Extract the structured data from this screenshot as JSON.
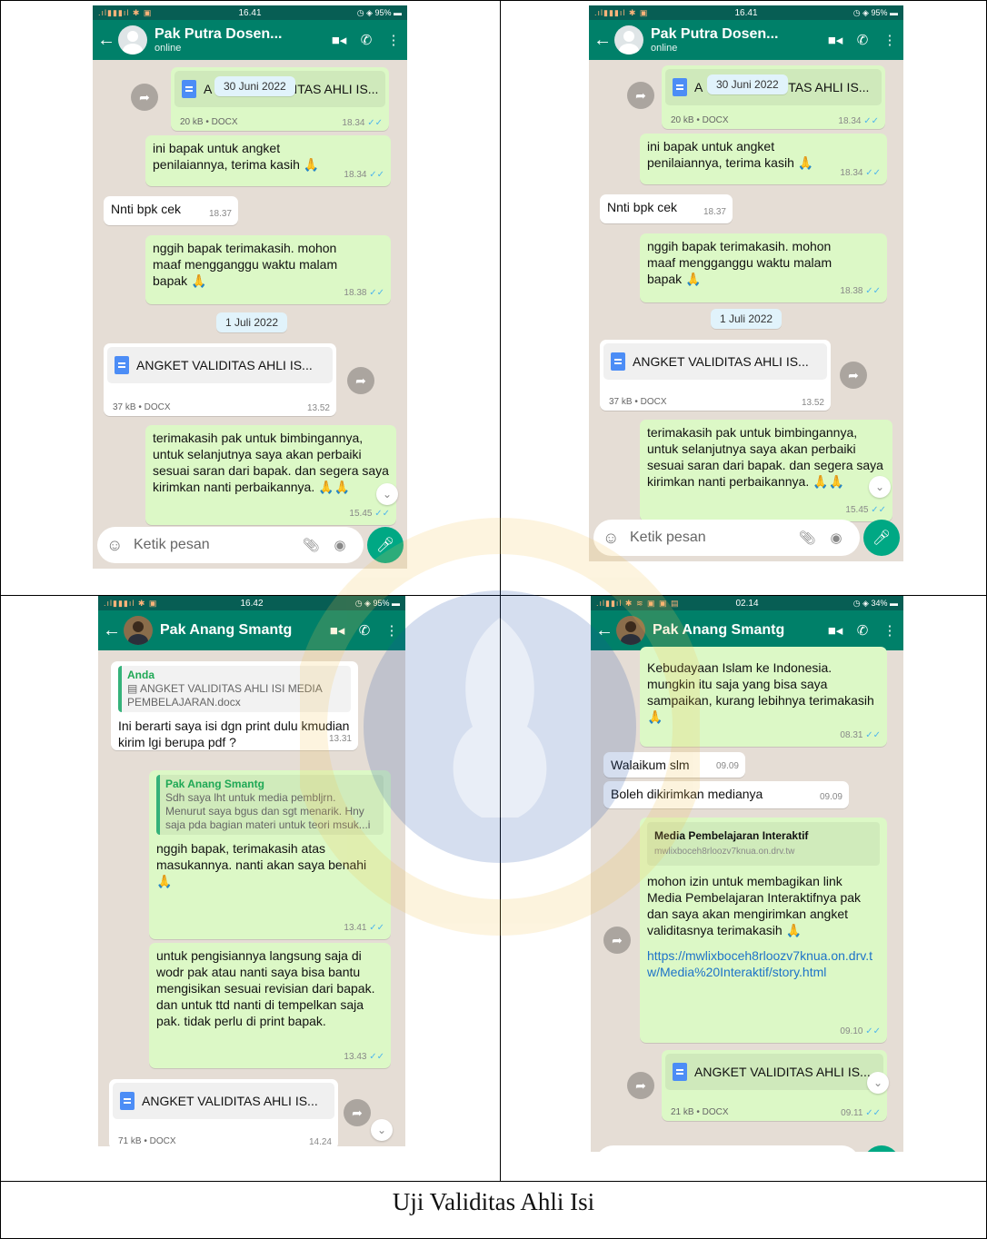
{
  "caption": "Uji Validitas Ahli Isi",
  "icons": {
    "back": "arrow-left-icon",
    "video": "video-camera-icon",
    "call": "phone-icon",
    "menu": "more-vert-icon",
    "forward": "forward-icon",
    "scroll": "chevron-down-icon",
    "emoji": "emoji-icon",
    "attach": "paperclip-icon",
    "camera": "camera-icon",
    "mic": "microphone-icon",
    "pray": "folded-hands-emoji"
  },
  "colors": {
    "header": "#008069",
    "outgoing": "#dcf8c6",
    "incoming": "#ffffff",
    "background": "#e5ddd5",
    "mic": "#00a884",
    "read_tick": "#4fb6ec"
  },
  "input_placeholder": "Ketik pesan",
  "phones": [
    {
      "status_time": "16.41",
      "battery": "95%",
      "contact": "Pak Putra Dosen...",
      "subtitle": "online",
      "file1_name": "A",
      "file1_name_end": "ITAS AHLI IS...",
      "file1_meta": "20 kB • DOCX",
      "file1_time": "18.34",
      "date_chip_1": "30 Juni 2022",
      "msg1": "ini bapak untuk angket penilaiannya, terima kasih 🙏",
      "msg1_time": "18.34",
      "msg2": "Nnti bpk cek",
      "msg2_time": "18.37",
      "msg3": "nggih bapak terimakasih. mohon maaf mengganggu waktu malam bapak 🙏",
      "msg3_time": "18.38",
      "date_chip_2": "1 Juli 2022",
      "file2_name": "ANGKET VALIDITAS AHLI IS...",
      "file2_meta": "37 kB • DOCX",
      "file2_time": "13.52",
      "msg4": "terimakasih pak untuk bimbingannya, untuk selanjutnya saya akan perbaiki sesuai saran dari bapak. dan segera saya kirimkan nanti perbaikannya. 🙏🙏",
      "msg4_time": "15.45"
    },
    {
      "status_time": "16.41",
      "battery": "95%",
      "contact": "Pak Putra Dosen...",
      "subtitle": "online",
      "file1_name": "A",
      "file1_name_end": "ITAS AHLI IS...",
      "file1_meta": "20 kB • DOCX",
      "file1_time": "18.34",
      "date_chip_1": "30 Juni 2022",
      "msg1": "ini bapak untuk angket penilaiannya, terima kasih 🙏",
      "msg1_time": "18.34",
      "msg2": "Nnti bpk cek",
      "msg2_time": "18.37",
      "msg3": "nggih bapak terimakasih. mohon maaf mengganggu waktu malam bapak 🙏",
      "msg3_time": "18.38",
      "date_chip_2": "1 Juli 2022",
      "file2_name": "ANGKET VALIDITAS AHLI IS...",
      "file2_meta": "37 kB • DOCX",
      "file2_time": "13.52",
      "msg4": "terimakasih pak untuk bimbingannya, untuk selanjutnya saya akan perbaiki sesuai saran dari bapak. dan segera saya kirimkan nanti perbaikannya. 🙏🙏",
      "msg4_time": "15.45"
    },
    {
      "status_time": "16.42",
      "battery": "95%",
      "contact": "Pak Anang Smantg",
      "q1_name": "Anda",
      "q1_text": "▤ ANGKET VALIDITAS AHLI ISI MEDIA PEMBELAJARAN.docx",
      "msg1": "Ini berarti saya isi dgn print dulu kmudian kirim lgi berupa pdf ?",
      "msg1_time": "13.31",
      "q2_name": "Pak Anang Smantg",
      "q2_text": "Sdh saya lht untuk media pembljrn. Menurut saya bgus dan sgt menarik. Hny saja pda bagian materi untuk teori msuk...i",
      "msg2": "nggih bapak, terimakasih atas masukannya. nanti akan saya benahi 🙏",
      "msg2_time": "13.41",
      "msg3": "untuk pengisiannya langsung saja di wodr pak atau nanti saya bisa bantu mengisikan sesuai revisian dari bapak. dan untuk ttd nanti di tempelkan saja pak. tidak perlu di print bapak.",
      "msg3_time": "13.43",
      "file_name": "ANGKET VALIDITAS AHLI IS...",
      "file_meta": "71 kB • DOCX",
      "file_time": "14.24"
    },
    {
      "status_time": "02.14",
      "battery": "34%",
      "contact": "Pak Anang Smantg",
      "msg1": "Kebudayaan Islam ke Indonesia. mungkin itu saja yang bisa saya sampaikan, kurang lebihnya terimakasih 🙏",
      "msg1_time": "08.31",
      "msg2": "Walaikum slm",
      "msg2_time": "09.09",
      "msg3": "Boleh dikirimkan medianya",
      "msg3_time": "09.09",
      "preview_title": "Media Pembelajaran Interaktif",
      "preview_url": "mwlixboceh8rloozv7knua.on.drv.tw",
      "msg4": "mohon izin untuk membagikan link Media Pembelajaran Interaktifnya pak dan saya akan mengirimkan angket validitasnya terimakasih 🙏",
      "msg4_link": "https://mwlixboceh8rloozv7knua.on.drv.tw/Media%20Interaktif/story.html",
      "msg4_time": "09.10",
      "file_name": "ANGKET VALIDITAS AHLI IS...",
      "file_meta": "21 kB • DOCX",
      "file_time": "09.11"
    }
  ]
}
